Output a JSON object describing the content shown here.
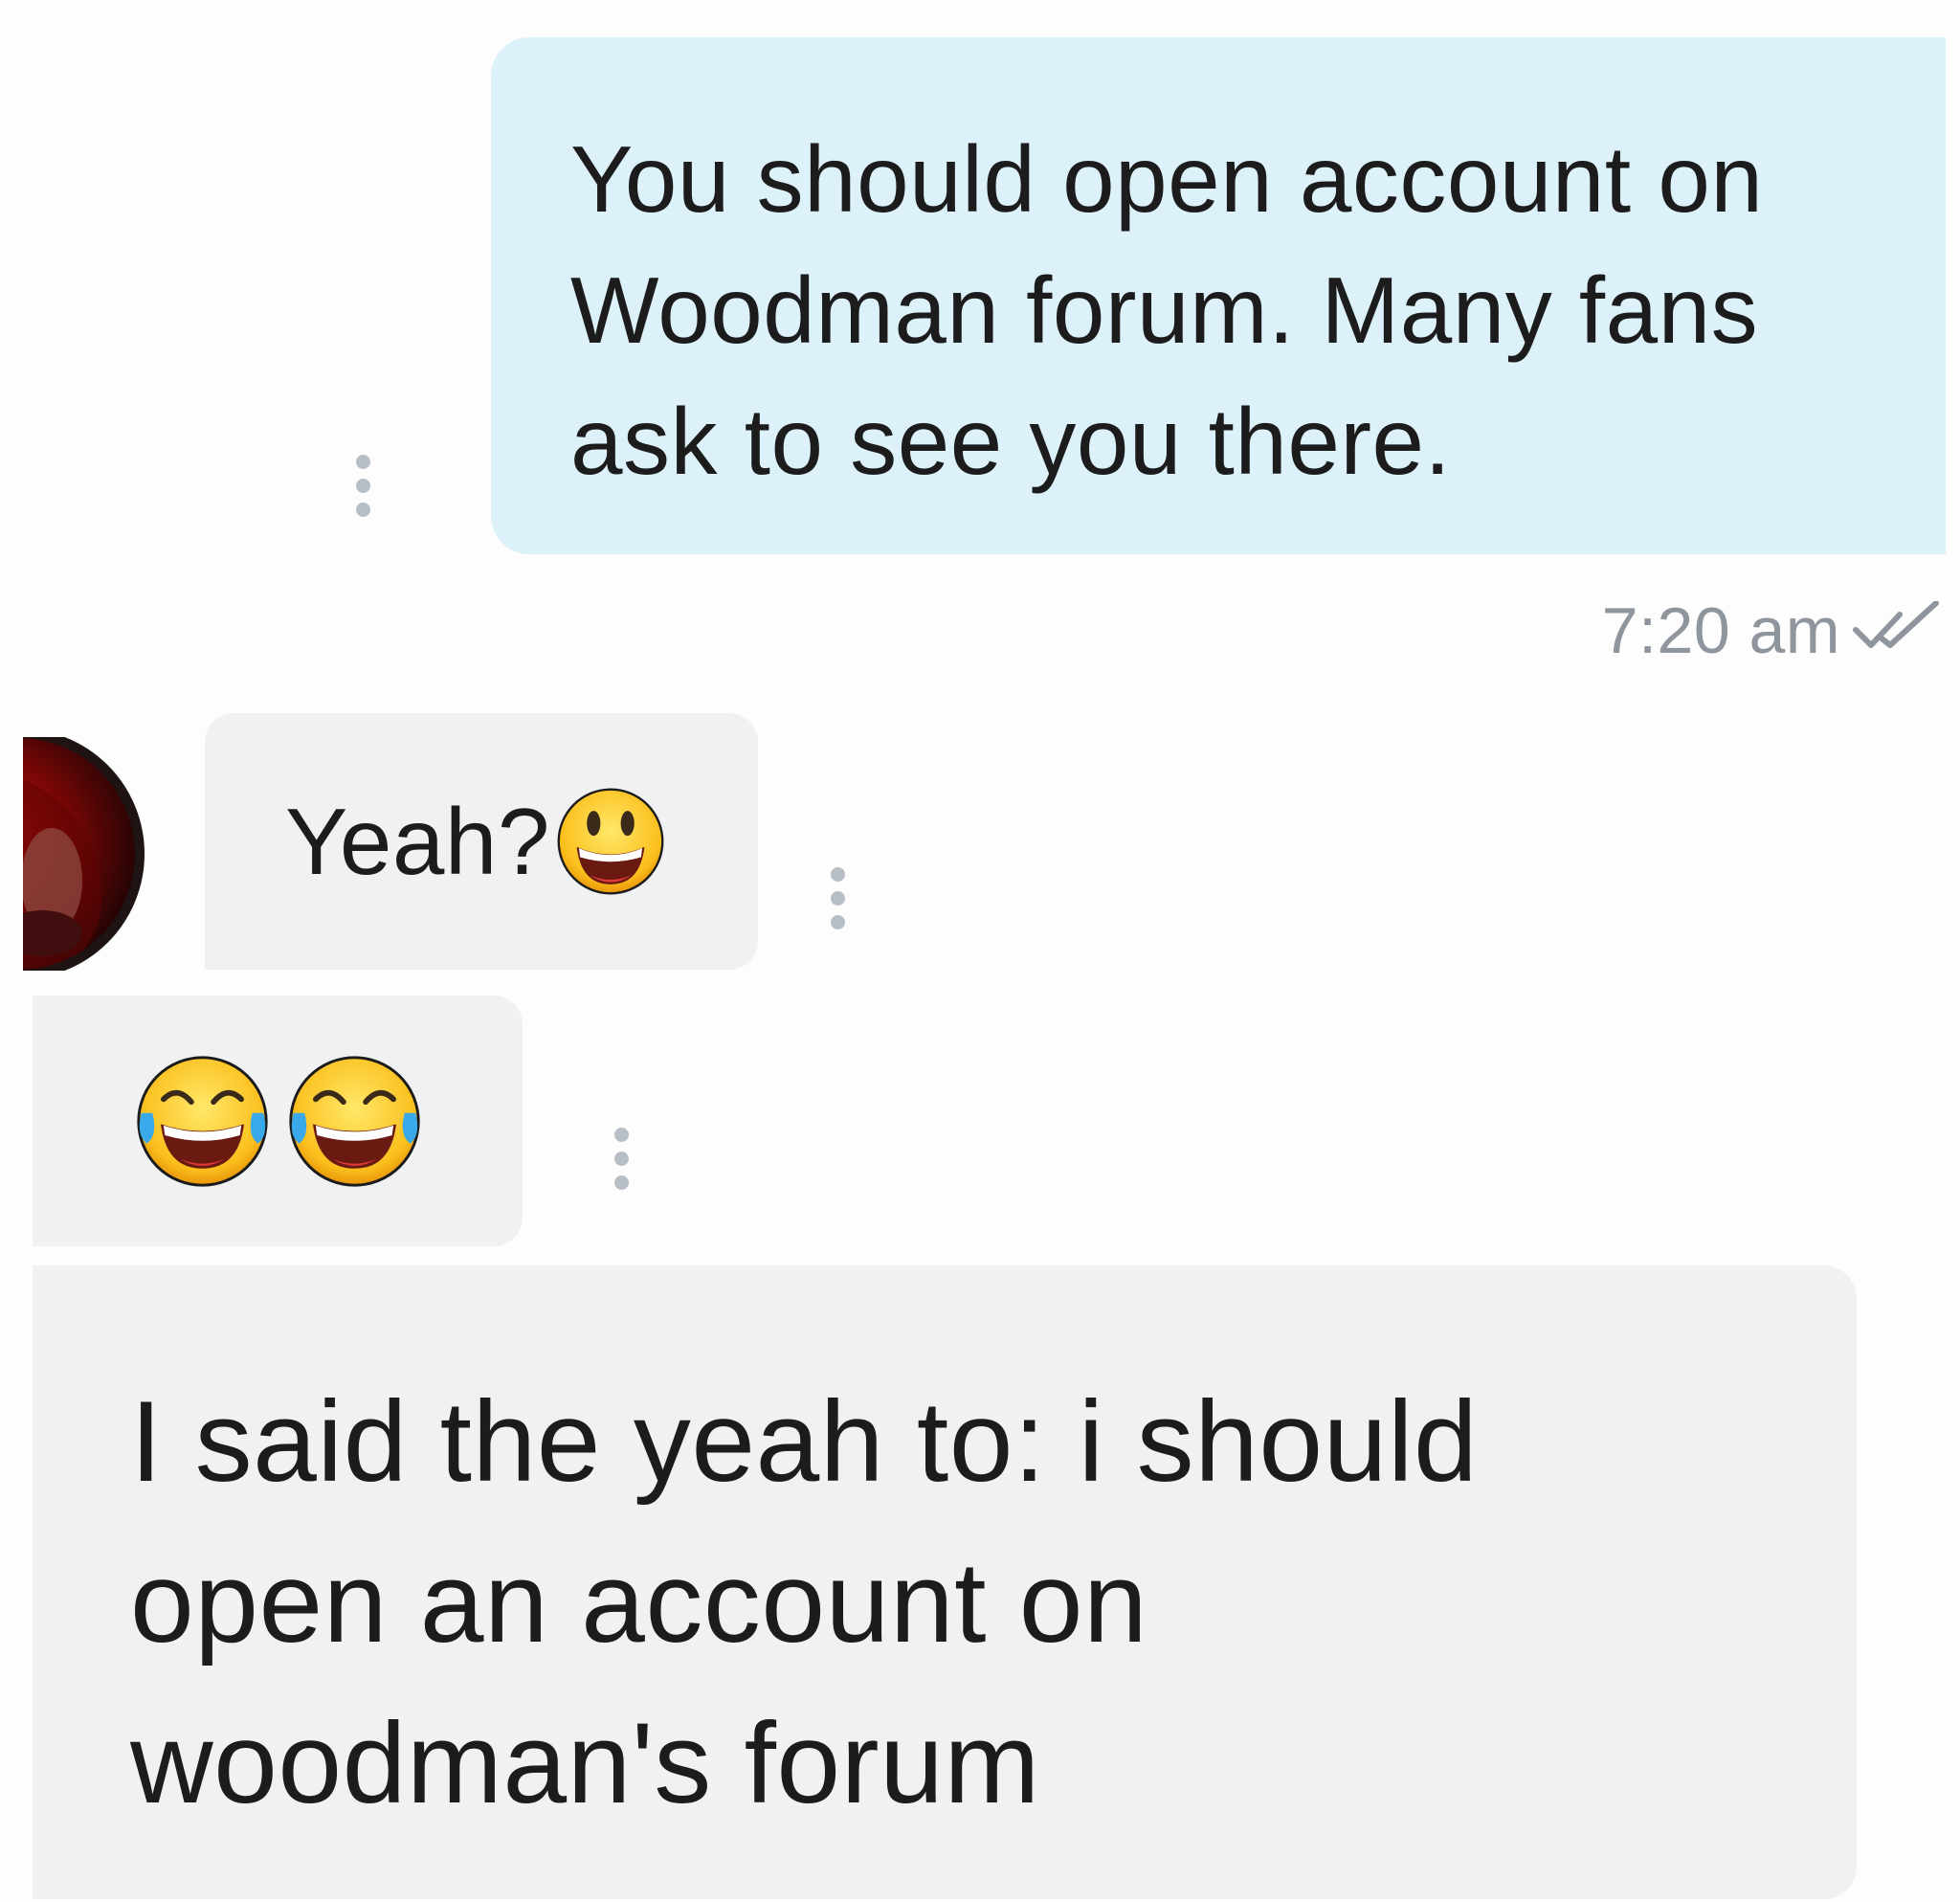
{
  "messages": [
    {
      "direction": "outgoing",
      "text": "You should open account on\nWoodman forum. Many fans\nask to see you there.",
      "time": "7:20 am",
      "status_icon": "double-check-icon"
    },
    {
      "direction": "incoming",
      "text": "Yeah?",
      "emoji": "grinning-face-emoji"
    },
    {
      "direction": "incoming",
      "emoji": [
        "face-with-tears-of-joy-emoji",
        "face-with-tears-of-joy-emoji"
      ]
    },
    {
      "direction": "incoming",
      "text": "I said the yeah to: i should\nopen an account on\nwoodman's forum"
    }
  ],
  "colors": {
    "outgoing_bubble": "#ddf1fb",
    "incoming_bubble": "#eff1f3",
    "meta_text": "#8e959d",
    "more_dots": "#b8bec6"
  }
}
